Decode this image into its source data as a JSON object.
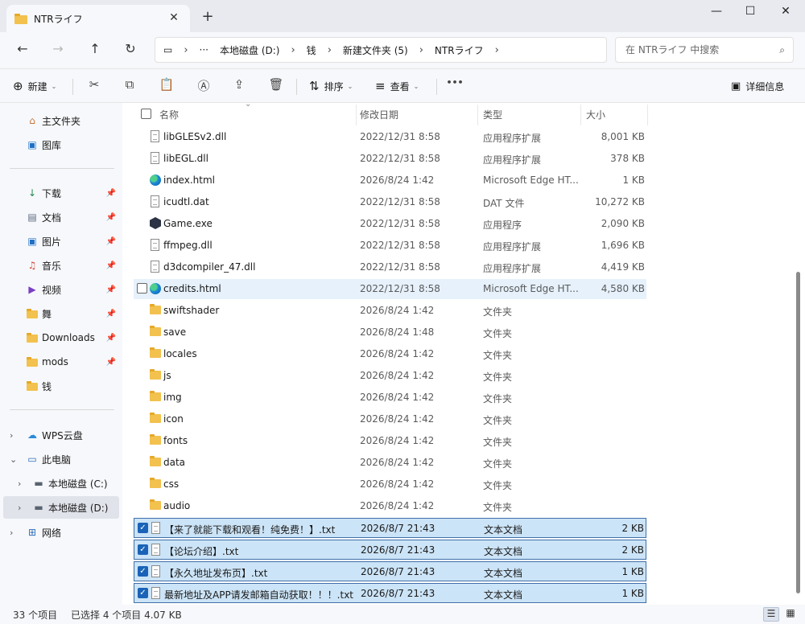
{
  "window": {
    "tab_title": "NTRライフ",
    "tab_close": "✕",
    "new_tab": "+",
    "minimize": "—",
    "maximize": "☐",
    "close": "✕"
  },
  "nav": {
    "back": "←",
    "forward": "→",
    "up": "↑",
    "refresh": "↻"
  },
  "address": {
    "pc_icon": "▭",
    "more": "···",
    "crumbs": [
      "本地磁盘 (D:)",
      "钱",
      "新建文件夹 (5)",
      "NTRライフ"
    ],
    "chevron": "›"
  },
  "search": {
    "placeholder": "在 NTRライフ 中搜索",
    "icon": "⌕"
  },
  "commands": {
    "new_label": "新建",
    "new_icon": "⊕",
    "cut_icon": "✂",
    "copy_icon": "⧉",
    "paste_icon": "📋",
    "rename_icon": "Ⓐ",
    "share_icon": "⇪",
    "delete_icon": "🗑",
    "sort_label": "排序",
    "sort_icon": "⇅",
    "view_label": "查看",
    "view_icon": "≡",
    "more_icon": "•••",
    "details_label": "详细信息",
    "details_icon": "▣",
    "caret": "⌄"
  },
  "sidebar": {
    "items": [
      {
        "label": "主文件夹",
        "icon": "home-icon",
        "glyph": "⌂"
      },
      {
        "label": "图库",
        "icon": "gallery-icon",
        "glyph": "▣"
      },
      {
        "label": "下载",
        "icon": "download-icon",
        "glyph": "↓"
      },
      {
        "label": "文档",
        "icon": "documents-icon",
        "glyph": "▤"
      },
      {
        "label": "图片",
        "icon": "pictures-icon",
        "glyph": "▣"
      },
      {
        "label": "音乐",
        "icon": "music-icon",
        "glyph": "♫"
      },
      {
        "label": "视频",
        "icon": "video-icon",
        "glyph": "▶"
      },
      {
        "label": "舞",
        "icon": "folder-icon",
        "glyph": ""
      },
      {
        "label": "Downloads",
        "icon": "folder-icon",
        "glyph": ""
      },
      {
        "label": "mods",
        "icon": "folder-icon",
        "glyph": ""
      },
      {
        "label": "钱",
        "icon": "folder-icon",
        "glyph": ""
      },
      {
        "label": "WPS云盘",
        "icon": "cloud-icon",
        "glyph": "☁"
      },
      {
        "label": "此电脑",
        "icon": "computer-icon",
        "glyph": "▭"
      },
      {
        "label": "本地磁盘 (C:)",
        "icon": "drive-icon",
        "glyph": "▬"
      },
      {
        "label": "本地磁盘 (D:)",
        "icon": "drive-icon",
        "glyph": "▬"
      },
      {
        "label": "网络",
        "icon": "network-icon",
        "glyph": "⊞"
      }
    ],
    "pin": "📌",
    "expand": "›",
    "collapse": "⌄"
  },
  "columns": {
    "name": "名称",
    "date": "修改日期",
    "type": "类型",
    "size": "大小",
    "sort_arrow": "⌄"
  },
  "files": [
    {
      "name": "libGLESv2.dll",
      "date": "2022/12/31 8:58",
      "type": "应用程序扩展",
      "size": "8,001 KB",
      "kind": "doc"
    },
    {
      "name": "libEGL.dll",
      "date": "2022/12/31 8:58",
      "type": "应用程序扩展",
      "size": "378 KB",
      "kind": "doc"
    },
    {
      "name": "index.html",
      "date": "2026/8/24 1:42",
      "type": "Microsoft Edge HT...",
      "size": "1 KB",
      "kind": "edge"
    },
    {
      "name": "icudtl.dat",
      "date": "2022/12/31 8:58",
      "type": "DAT 文件",
      "size": "10,272 KB",
      "kind": "doc"
    },
    {
      "name": "Game.exe",
      "date": "2022/12/31 8:58",
      "type": "应用程序",
      "size": "2,090 KB",
      "kind": "exe"
    },
    {
      "name": "ffmpeg.dll",
      "date": "2022/12/31 8:58",
      "type": "应用程序扩展",
      "size": "1,696 KB",
      "kind": "doc"
    },
    {
      "name": "d3dcompiler_47.dll",
      "date": "2022/12/31 8:58",
      "type": "应用程序扩展",
      "size": "4,419 KB",
      "kind": "doc"
    },
    {
      "name": "credits.html",
      "date": "2022/12/31 8:58",
      "type": "Microsoft Edge HT...",
      "size": "4,580 KB",
      "kind": "edge"
    },
    {
      "name": "swiftshader",
      "date": "2026/8/24 1:42",
      "type": "文件夹",
      "size": "",
      "kind": "folder"
    },
    {
      "name": "save",
      "date": "2026/8/24 1:48",
      "type": "文件夹",
      "size": "",
      "kind": "folder"
    },
    {
      "name": "locales",
      "date": "2026/8/24 1:42",
      "type": "文件夹",
      "size": "",
      "kind": "folder"
    },
    {
      "name": "js",
      "date": "2026/8/24 1:42",
      "type": "文件夹",
      "size": "",
      "kind": "folder"
    },
    {
      "name": "img",
      "date": "2026/8/24 1:42",
      "type": "文件夹",
      "size": "",
      "kind": "folder"
    },
    {
      "name": "icon",
      "date": "2026/8/24 1:42",
      "type": "文件夹",
      "size": "",
      "kind": "folder"
    },
    {
      "name": "fonts",
      "date": "2026/8/24 1:42",
      "type": "文件夹",
      "size": "",
      "kind": "folder"
    },
    {
      "name": "data",
      "date": "2026/8/24 1:42",
      "type": "文件夹",
      "size": "",
      "kind": "folder"
    },
    {
      "name": "css",
      "date": "2026/8/24 1:42",
      "type": "文件夹",
      "size": "",
      "kind": "folder"
    },
    {
      "name": "audio",
      "date": "2026/8/24 1:42",
      "type": "文件夹",
      "size": "",
      "kind": "folder"
    },
    {
      "name": "【来了就能下载和观看！纯免费！】.txt",
      "date": "2026/8/7 21:43",
      "type": "文本文档",
      "size": "2 KB",
      "kind": "doc"
    },
    {
      "name": "【论坛介绍】.txt",
      "date": "2026/8/7 21:43",
      "type": "文本文档",
      "size": "2 KB",
      "kind": "doc"
    },
    {
      "name": "【永久地址发布页】.txt",
      "date": "2026/8/7 21:43",
      "type": "文本文档",
      "size": "1 KB",
      "kind": "doc"
    },
    {
      "name": "最新地址及APP请发邮箱自动获取！！！.txt",
      "date": "2026/8/7 21:43",
      "type": "文本文档",
      "size": "1 KB",
      "kind": "doc"
    }
  ],
  "status": {
    "count": "33 个项目",
    "selected": "已选择 4 个项目  4.07 KB",
    "details_view": "☰",
    "tiles_view": "▦"
  }
}
